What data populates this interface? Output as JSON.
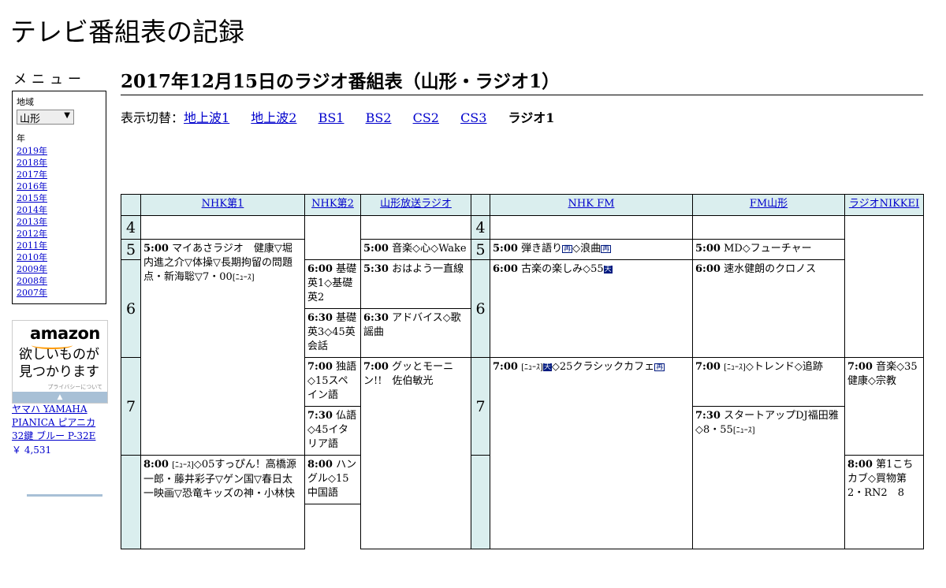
{
  "site_title": "テレビ番組表の記録",
  "menu": {
    "heading": "メニュー",
    "region_label": "地域",
    "region_value": "山形",
    "region_arrow": "▼",
    "year_label": "年",
    "years": [
      "2019年",
      "2018年",
      "2017年",
      "2016年",
      "2015年",
      "2014年",
      "2013年",
      "2012年",
      "2011年",
      "2010年",
      "2009年",
      "2008年",
      "2007年"
    ]
  },
  "ad": {
    "logo": "amazon",
    "tagline": "欲しいものが見つかります",
    "privacy": "プライバシーについて",
    "bar_arrow": "▲",
    "product": "ヤマハ YAMAHA PIANICA ピアニカ 32鍵 ブルー P-32E",
    "price": "￥ 4,531"
  },
  "page_heading": "2017年12月15日のラジオ番組表（山形・ラジオ1）",
  "switcher": {
    "label": "表示切替：",
    "links": [
      "地上波1",
      "地上波2",
      "BS1",
      "BS2",
      "CS2",
      "CS3"
    ],
    "current": "ラジオ1"
  },
  "channels": [
    "NHK第1",
    "NHK第2",
    "山形放送ラジオ",
    "NHK FM",
    "FM山形",
    "ラジオNIKKEI"
  ],
  "hours": [
    "4",
    "5",
    "6",
    "7"
  ],
  "programs": {
    "nhk1_5_time": "5:00",
    "nhk1_5_title": "マイあさラジオ　健康▽堀内進之介▽体操▽長期拘留の問題点・新海聡▽7・00",
    "nhk1_5_news": "[ﾆｭｰｽ]",
    "nhk1_8_time": "8:00",
    "nhk1_8_news": "[ﾆｭｰｽ]",
    "nhk1_8_title": "◇05すっぴん！高橋源一郎・藤井彩子▽ゲン国▽春日太一映画▽恐竜キッズの神・小林快",
    "nhk2_6_time": "6:00",
    "nhk2_6_title": "基礎英1◇基礎英2",
    "nhk2_630_time": "6:30",
    "nhk2_630_title": "基礎英3◇45英会話",
    "nhk2_7_time": "7:00",
    "nhk2_7_title": "独語◇15スペイン語",
    "nhk2_730_time": "7:30",
    "nhk2_730_title": "仏語◇45イタリア語",
    "nhk2_8_time": "8:00",
    "nhk2_8_title": "ハングル◇15中国語",
    "ybc_5_time": "5:00",
    "ybc_5_title": "音楽◇心◇Wake",
    "ybc_530_time": "5:30",
    "ybc_530_title": "おはよう一直線",
    "ybc_630_time": "6:30",
    "ybc_630_title": "アドバイス◇歌謡曲",
    "ybc_7_time": "7:00",
    "ybc_7_title": "グッとモーニン!!　佐伯敏光",
    "fm_5_time": "5:00",
    "fm_5_title_a": "弾き語り",
    "fm_5_title_b": "◇浪曲",
    "fm_6_time": "6:00",
    "fm_6_title": "古楽の楽しみ◇55",
    "fm_7_time": "7:00",
    "fm_7_news": "[ﾆｭｰｽ]",
    "fm_7_title": "◇25クラシックカフェ",
    "fmy_5_time": "5:00",
    "fmy_5_title": "MD◇フューチャー",
    "fmy_6_time": "6:00",
    "fmy_6_title": "速水健朗のクロノス",
    "fmy_7_time": "7:00",
    "fmy_7_news": "[ﾆｭｰｽ]",
    "fmy_7_title": "◇トレンド◇追跡",
    "fmy_730_time": "7:30",
    "fmy_730_title": "スタートアップDJ福田雅◇8・55",
    "fmy_730_news": "[ﾆｭｰｽ]",
    "nikkei_7_time": "7:00",
    "nikkei_7_title": "音楽◇35健康◇宗教",
    "nikkei_8_time": "8:00",
    "nikkei_8_title": "第1こちカブ◇買物第2・RN2　8"
  },
  "badges": {
    "ten": "天",
    "sai": "再"
  }
}
